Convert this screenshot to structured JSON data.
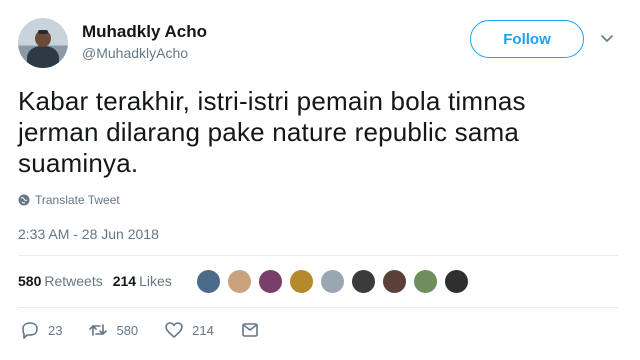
{
  "user": {
    "name": "Muhadkly Acho",
    "handle": "@MuhadklyAcho"
  },
  "follow": {
    "label": "Follow"
  },
  "tweet": {
    "lines": [
      "Kabar terakhir, istri-istri pemain bola timnas",
      "jerman dilarang pake nature republic sama",
      "suaminya."
    ]
  },
  "translate": {
    "label": "Translate Tweet"
  },
  "timestamp": "2:33 AM - 28 Jun 2018",
  "stats": {
    "retweets_count": "580",
    "retweets_label": "Retweets",
    "likes_count": "214",
    "likes_label": "Likes"
  },
  "likers_colors": [
    "#4a6b8a",
    "#c9a27e",
    "#7a3e6b",
    "#b58a2b",
    "#9aa7b3",
    "#3b3b3b",
    "#5a4036",
    "#6d8f5e",
    "#2f2f2f"
  ],
  "actions": {
    "reply_count": "23",
    "retweet_count": "580",
    "like_count": "214"
  },
  "colors": {
    "accent": "#1da1f2",
    "secondary_text": "#657786",
    "primary_text": "#14171a"
  },
  "icons": {
    "caret": "chevron-down-icon",
    "translate": "globe-icon",
    "reply": "reply-icon",
    "retweet": "retweet-icon",
    "like": "heart-icon",
    "message": "envelope-icon"
  }
}
